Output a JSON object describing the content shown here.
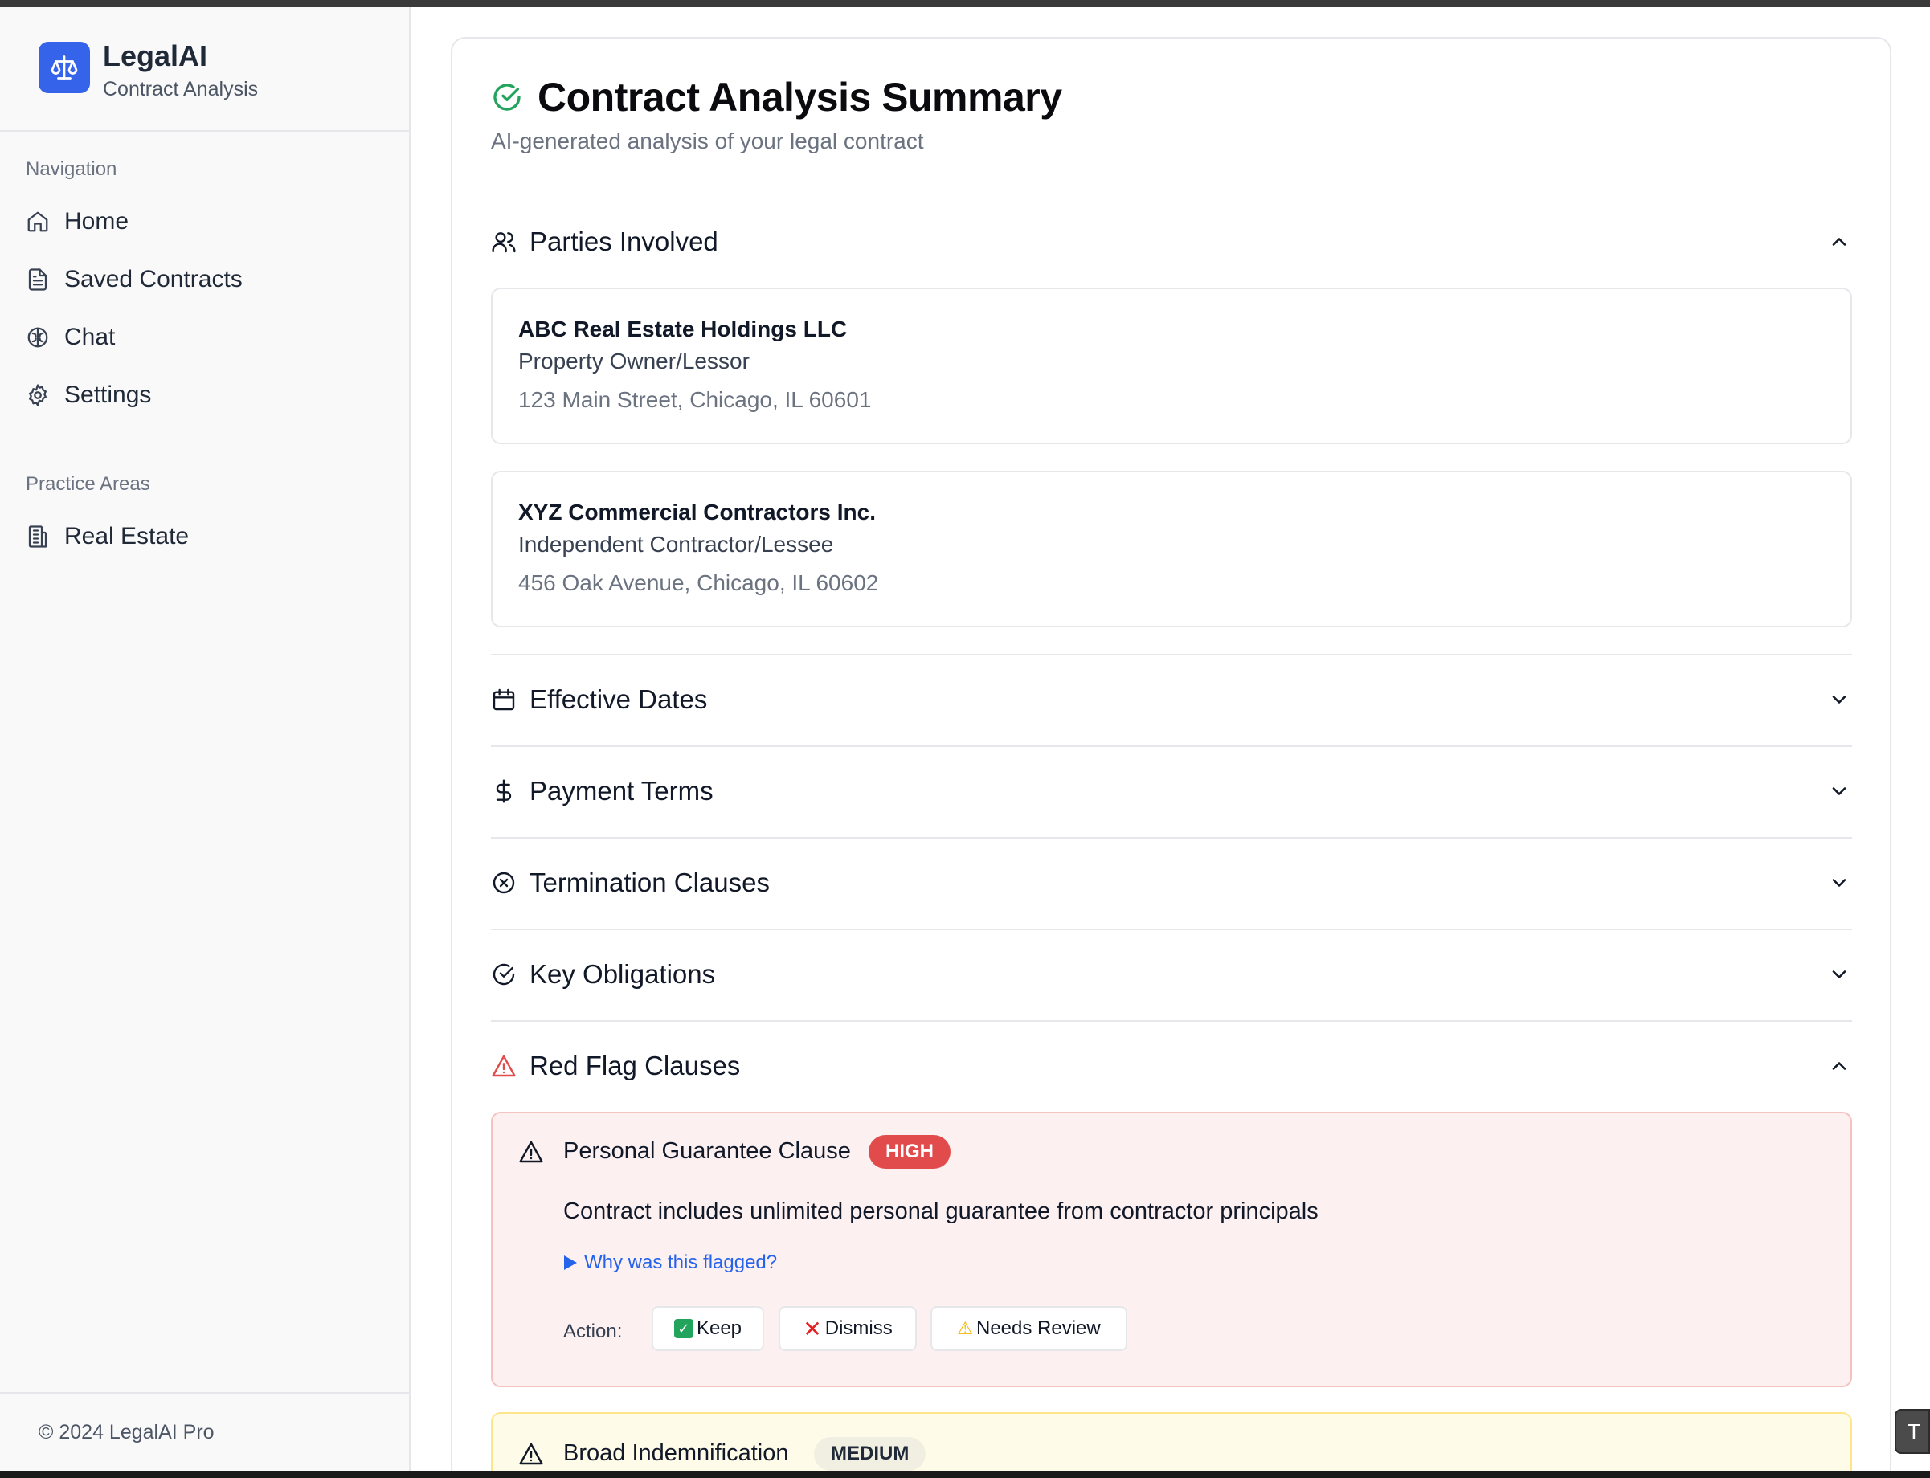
{
  "brand": {
    "name": "LegalAI",
    "subtitle": "Contract Analysis"
  },
  "sidebar": {
    "nav_label": "Navigation",
    "items": [
      {
        "label": "Home",
        "icon": "home-icon"
      },
      {
        "label": "Saved Contracts",
        "icon": "file-text-icon"
      },
      {
        "label": "Chat",
        "icon": "brain-icon"
      },
      {
        "label": "Settings",
        "icon": "gear-icon"
      }
    ],
    "practice_label": "Practice Areas",
    "practice_items": [
      {
        "label": "Real Estate",
        "icon": "building-icon"
      }
    ],
    "footer": "© 2024 LegalAI Pro"
  },
  "main": {
    "title": "Contract Analysis Summary",
    "subtitle": "AI-generated analysis of your legal contract",
    "sections": {
      "parties": "Parties Involved",
      "dates": "Effective Dates",
      "payment": "Payment Terms",
      "termination": "Termination Clauses",
      "obligations": "Key Obligations",
      "red_flags": "Red Flag Clauses"
    },
    "parties": [
      {
        "name": "ABC Real Estate Holdings LLC",
        "role": "Property Owner/Lessor",
        "address": "123 Main Street, Chicago, IL 60601"
      },
      {
        "name": "XYZ Commercial Contractors Inc.",
        "role": "Independent Contractor/Lessee",
        "address": "456 Oak Avenue, Chicago, IL 60602"
      }
    ],
    "red_flags": [
      {
        "title": "Personal Guarantee Clause",
        "severity": "HIGH",
        "description": "Contract includes unlimited personal guarantee from contractor principals",
        "why": "Why was this flagged?",
        "action_label": "Action:",
        "actions": {
          "keep": "Keep",
          "dismiss": "Dismiss",
          "review": "Needs Review"
        }
      },
      {
        "title": "Broad Indemnification",
        "severity": "MEDIUM"
      }
    ]
  },
  "toast_letter": "T",
  "colors": {
    "accent": "#3563e9",
    "success": "#22a45d",
    "danger": "#e24b4b",
    "link": "#2563eb"
  }
}
